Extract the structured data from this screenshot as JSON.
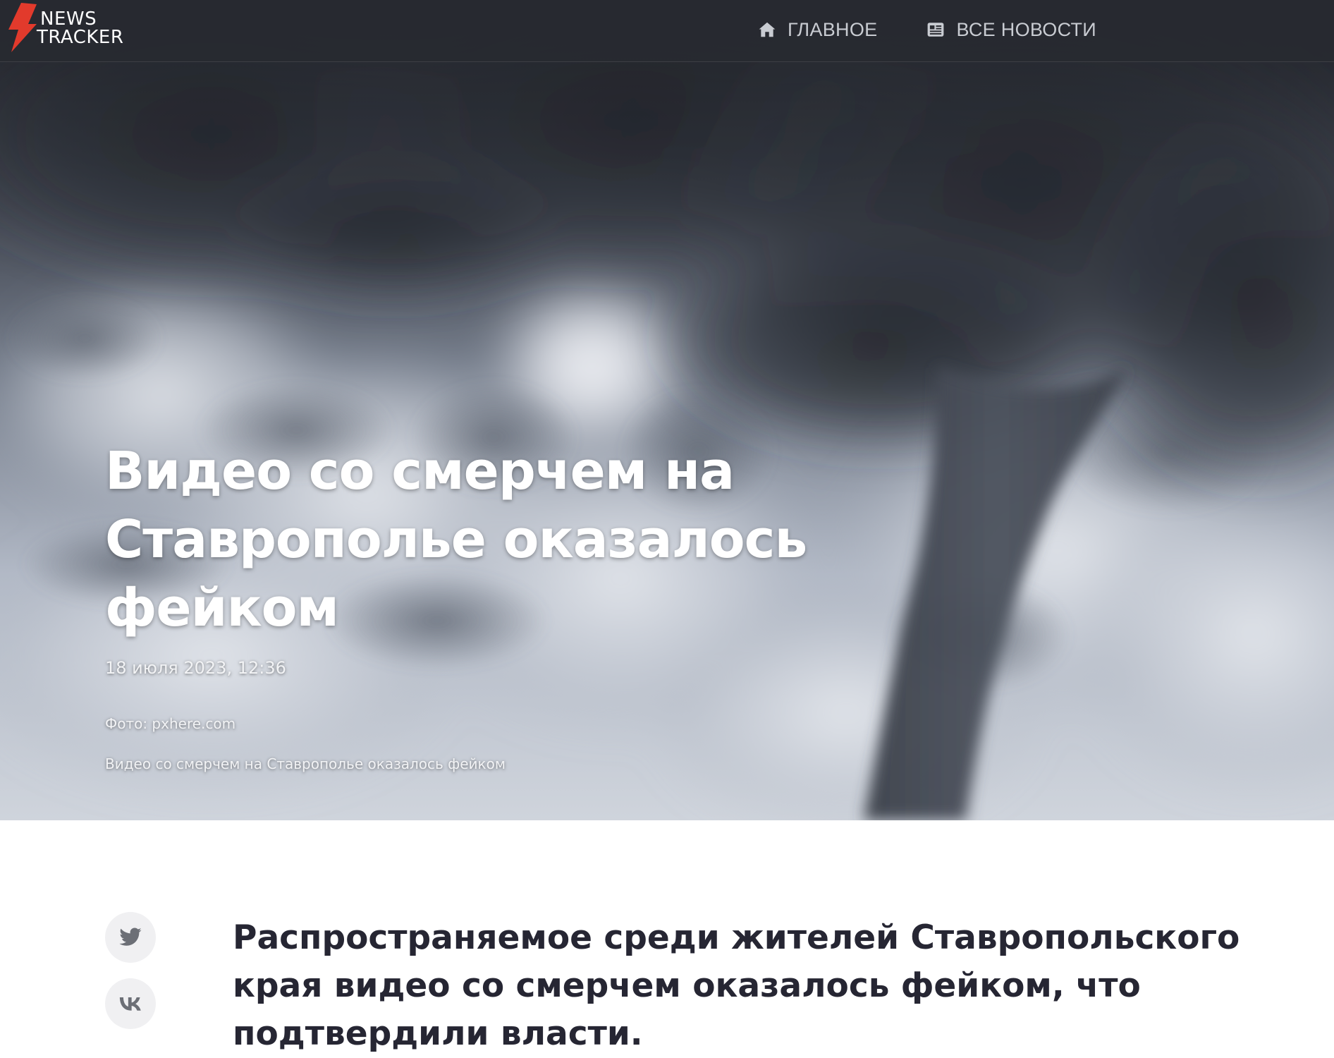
{
  "header": {
    "logo": {
      "line1": "NEWS",
      "line2": "TRACKER",
      "accent_color": "#e23a2c"
    },
    "nav": [
      {
        "label": "ГЛАВНОЕ",
        "icon": "home-icon"
      },
      {
        "label": "ВСЕ НОВОСТИ",
        "icon": "newspaper-icon"
      }
    ]
  },
  "hero": {
    "title": "Видео со смерчем на Ставрополье оказалось фейком",
    "date": "18 июля 2023, 12:36",
    "photo_credit": "Фото: pxhere.com",
    "caption": "Видео со смерчем на Ставрополье оказалось фейком",
    "image_subject": "tornado funnel cloud under storm clouds"
  },
  "share": [
    {
      "network": "twitter",
      "icon": "twitter-icon"
    },
    {
      "network": "vk",
      "icon": "vk-icon"
    }
  ],
  "article": {
    "lead": "Распространяемое среди жителей Ставропольского края видео со смерчем оказалось фейком, что подтвердили власти."
  },
  "colors": {
    "header_bg": "#282a30",
    "nav_text": "#c9ccd2",
    "lead_text": "#262633",
    "share_bg": "#f0f0f2",
    "share_icon": "#6c6f76"
  }
}
